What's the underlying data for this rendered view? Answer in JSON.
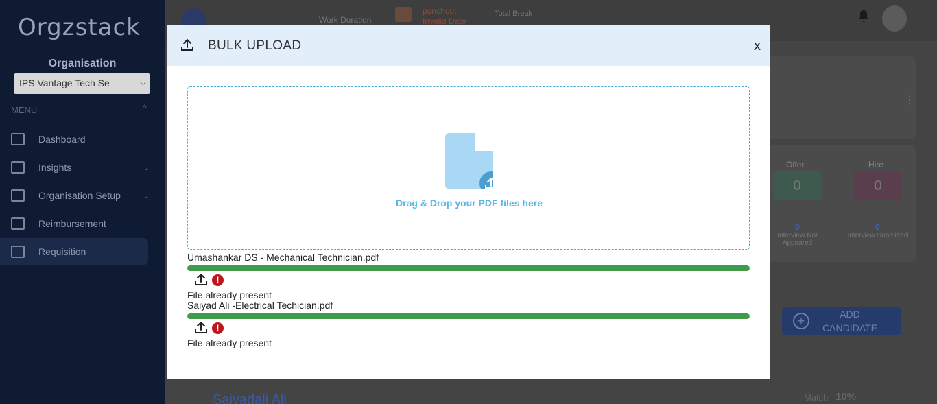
{
  "app": {
    "logo_text": "Orgzstack",
    "organisation_label": "Organisation",
    "organisation_selected": "IPS Vantage Tech Se",
    "menu_label": "MENU",
    "nav": [
      {
        "label": "Dashboard"
      },
      {
        "label": "Insights"
      },
      {
        "label": "Organisation Setup"
      },
      {
        "label": "Reimbursement"
      },
      {
        "label": "Requisition"
      }
    ],
    "topbar": {
      "work_duration_label": "Work Duration",
      "punchout_label": "punchout",
      "invalid_date": "Invalid Date",
      "total_break_label": "Total Break"
    },
    "stats": {
      "offer_label": "Offer",
      "offer_value": "0",
      "hire_label": "Hire",
      "hire_value": "0",
      "interview_not_appeared_value": "0",
      "interview_not_appeared_label": "Interview Not Appeared",
      "interview_submitted_value": "0",
      "interview_submitted_label": "Interview Submitted"
    },
    "add_candidate_label": "ADD CANDIDATE",
    "candidate_name": "Saiyadali Ali",
    "match_label": "Match",
    "match_value": "10%"
  },
  "modal": {
    "title": "BULK UPLOAD",
    "close_label": "x",
    "dropzone_text": "Drag & Drop your PDF files here",
    "files": [
      {
        "name": "Umashankar DS - Mechanical Technician.pdf",
        "progress": 1.0,
        "status": "File already present"
      },
      {
        "name": "Saiyad Ali -Electrical Techician.pdf",
        "progress": 1.0,
        "status": "File already present"
      }
    ]
  },
  "colors": {
    "header_bg": "#e3eefb",
    "progress_green": "#3f9a4a",
    "error_red": "#c0161b",
    "dropzone_border": "#4aa9d9",
    "dropzone_text": "#5ab6e6"
  }
}
